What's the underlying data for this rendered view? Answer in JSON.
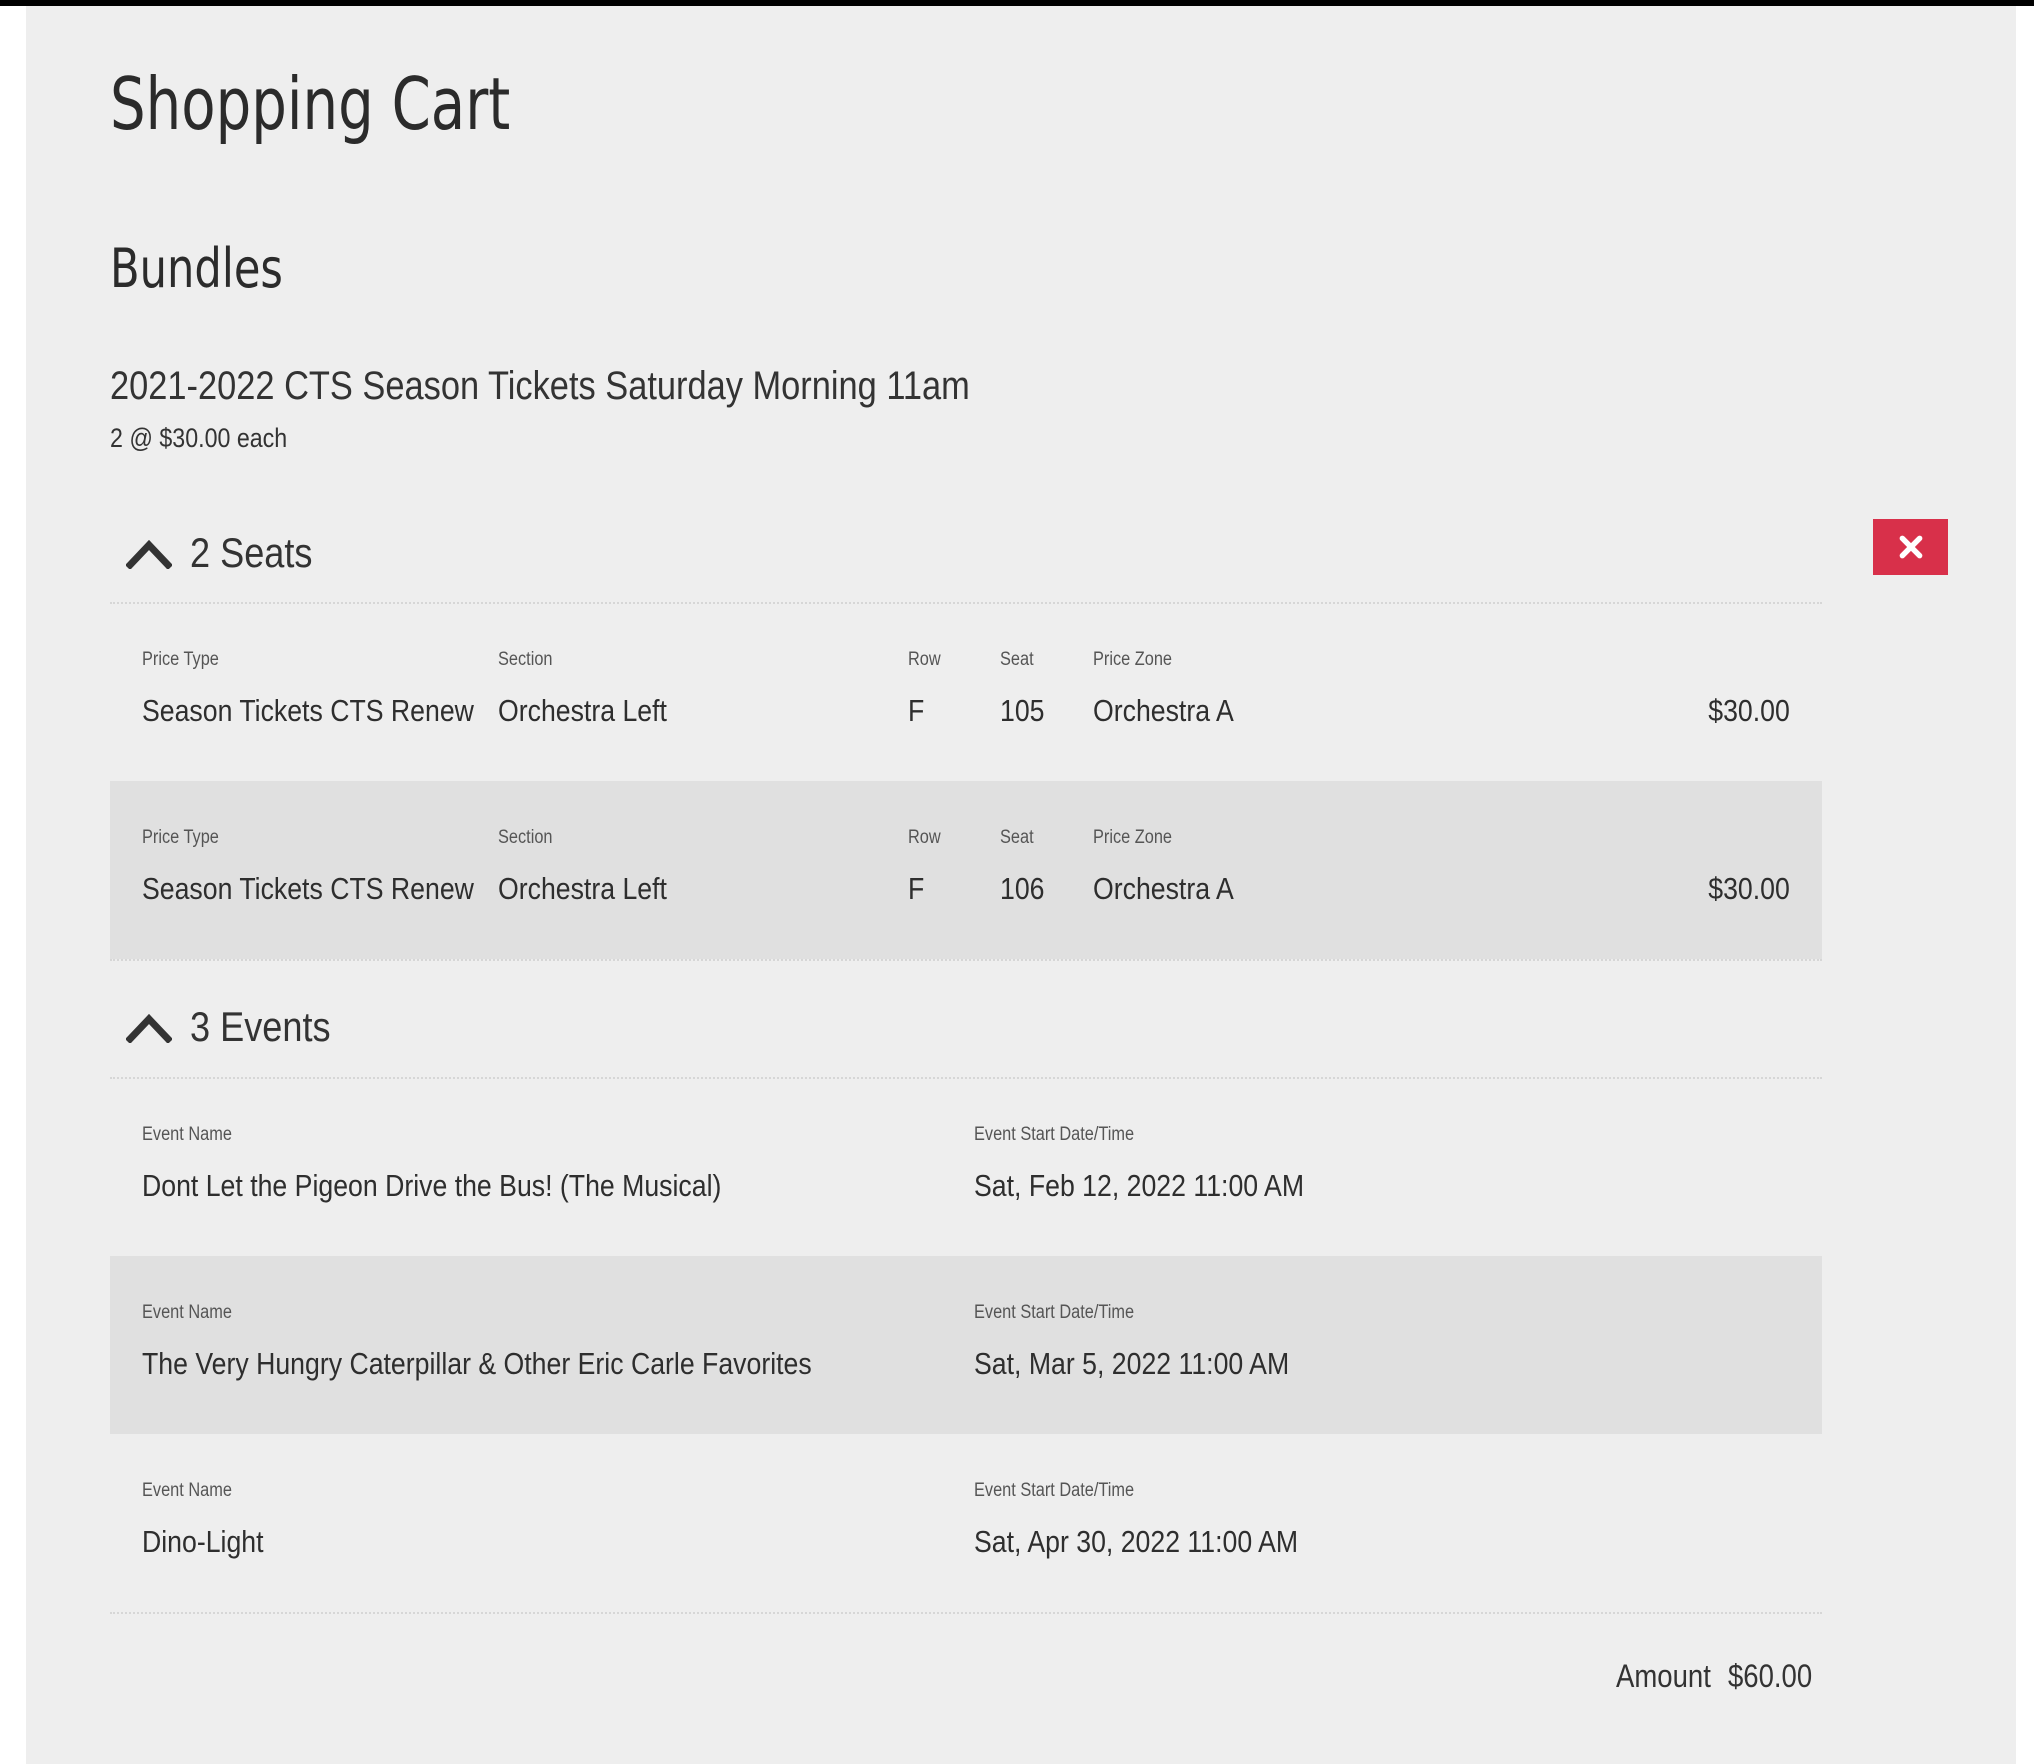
{
  "page": {
    "title": "Shopping Cart"
  },
  "bundles_section": {
    "title": "Bundles"
  },
  "bundle": {
    "name": "2021-2022 CTS Season Tickets Saturday Morning 11am",
    "quantity_text": "2 @ $30.00 each",
    "delete_icon": "close-icon",
    "accent_color": "#d8304a"
  },
  "seats": {
    "header": "2 Seats",
    "icon": "chevron-up-icon",
    "labels": {
      "price_type": "Price Type",
      "section": "Section",
      "row": "Row",
      "seat": "Seat",
      "price_zone": "Price Zone"
    },
    "items": [
      {
        "price_type": "Season Tickets CTS Renew",
        "section": "Orchestra Left",
        "row": "F",
        "seat": "105",
        "price_zone": "Orchestra A",
        "price": "$30.00"
      },
      {
        "price_type": "Season Tickets CTS Renew",
        "section": "Orchestra Left",
        "row": "F",
        "seat": "106",
        "price_zone": "Orchestra A",
        "price": "$30.00"
      }
    ]
  },
  "events": {
    "header": "3 Events",
    "icon": "chevron-up-icon",
    "labels": {
      "event_name": "Event Name",
      "event_start": "Event Start Date/Time"
    },
    "items": [
      {
        "event_name": "Dont Let the Pigeon Drive the Bus! (The Musical)",
        "event_start": "Sat, Feb 12, 2022 11:00 AM"
      },
      {
        "event_name": "The Very Hungry Caterpillar & Other Eric Carle Favorites",
        "event_start": "Sat, Mar 5, 2022 11:00 AM"
      },
      {
        "event_name": "Dino-Light",
        "event_start": "Sat, Apr 30, 2022 11:00 AM"
      }
    ]
  },
  "summary": {
    "amount_label": "Amount",
    "amount_value": "$60.00"
  }
}
